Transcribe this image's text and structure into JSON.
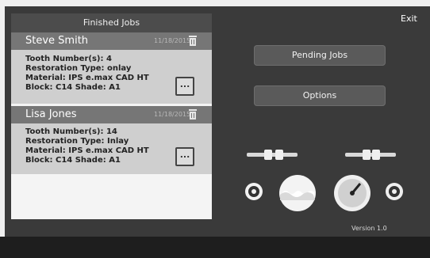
{
  "panel": {
    "title": "Finished Jobs"
  },
  "header": {
    "exit_label": "Exit"
  },
  "jobs": [
    {
      "name": "Steve Smith",
      "date": "11/18/2015",
      "tooth": "Tooth Number(s): 4",
      "restoration": "Restoration Type: onlay",
      "material": "Material: IPS e.max CAD HT",
      "block_shade": "Block: C14   Shade: A1",
      "more_label": "..."
    },
    {
      "name": "Lisa Jones",
      "date": "11/18/2015",
      "tooth": "Tooth Number(s): 14",
      "restoration": "Restoration Type: Inlay",
      "material": "Material: IPS e.max CAD HT",
      "block_shade": "Block: C14   Shade: A1",
      "more_label": "..."
    }
  ],
  "actions": {
    "pending_jobs": "Pending Jobs",
    "options": "Options"
  },
  "footer": {
    "version": "Version 1.0"
  },
  "icons": {
    "trash": "trash-icon",
    "left_slider": "slider-icon",
    "right_slider": "slider-icon",
    "left_round": "timer-icon",
    "water": "water-level-icon",
    "gauge": "gauge-icon",
    "right_round": "dial-icon"
  },
  "colors": {
    "window_bg": "#3a3a3a",
    "panel_header": "#4c4c4c",
    "job_header": "#767676",
    "job_body": "#cfcfcf",
    "button": "#5a5a5a",
    "text_light": "#f2f2f2"
  }
}
